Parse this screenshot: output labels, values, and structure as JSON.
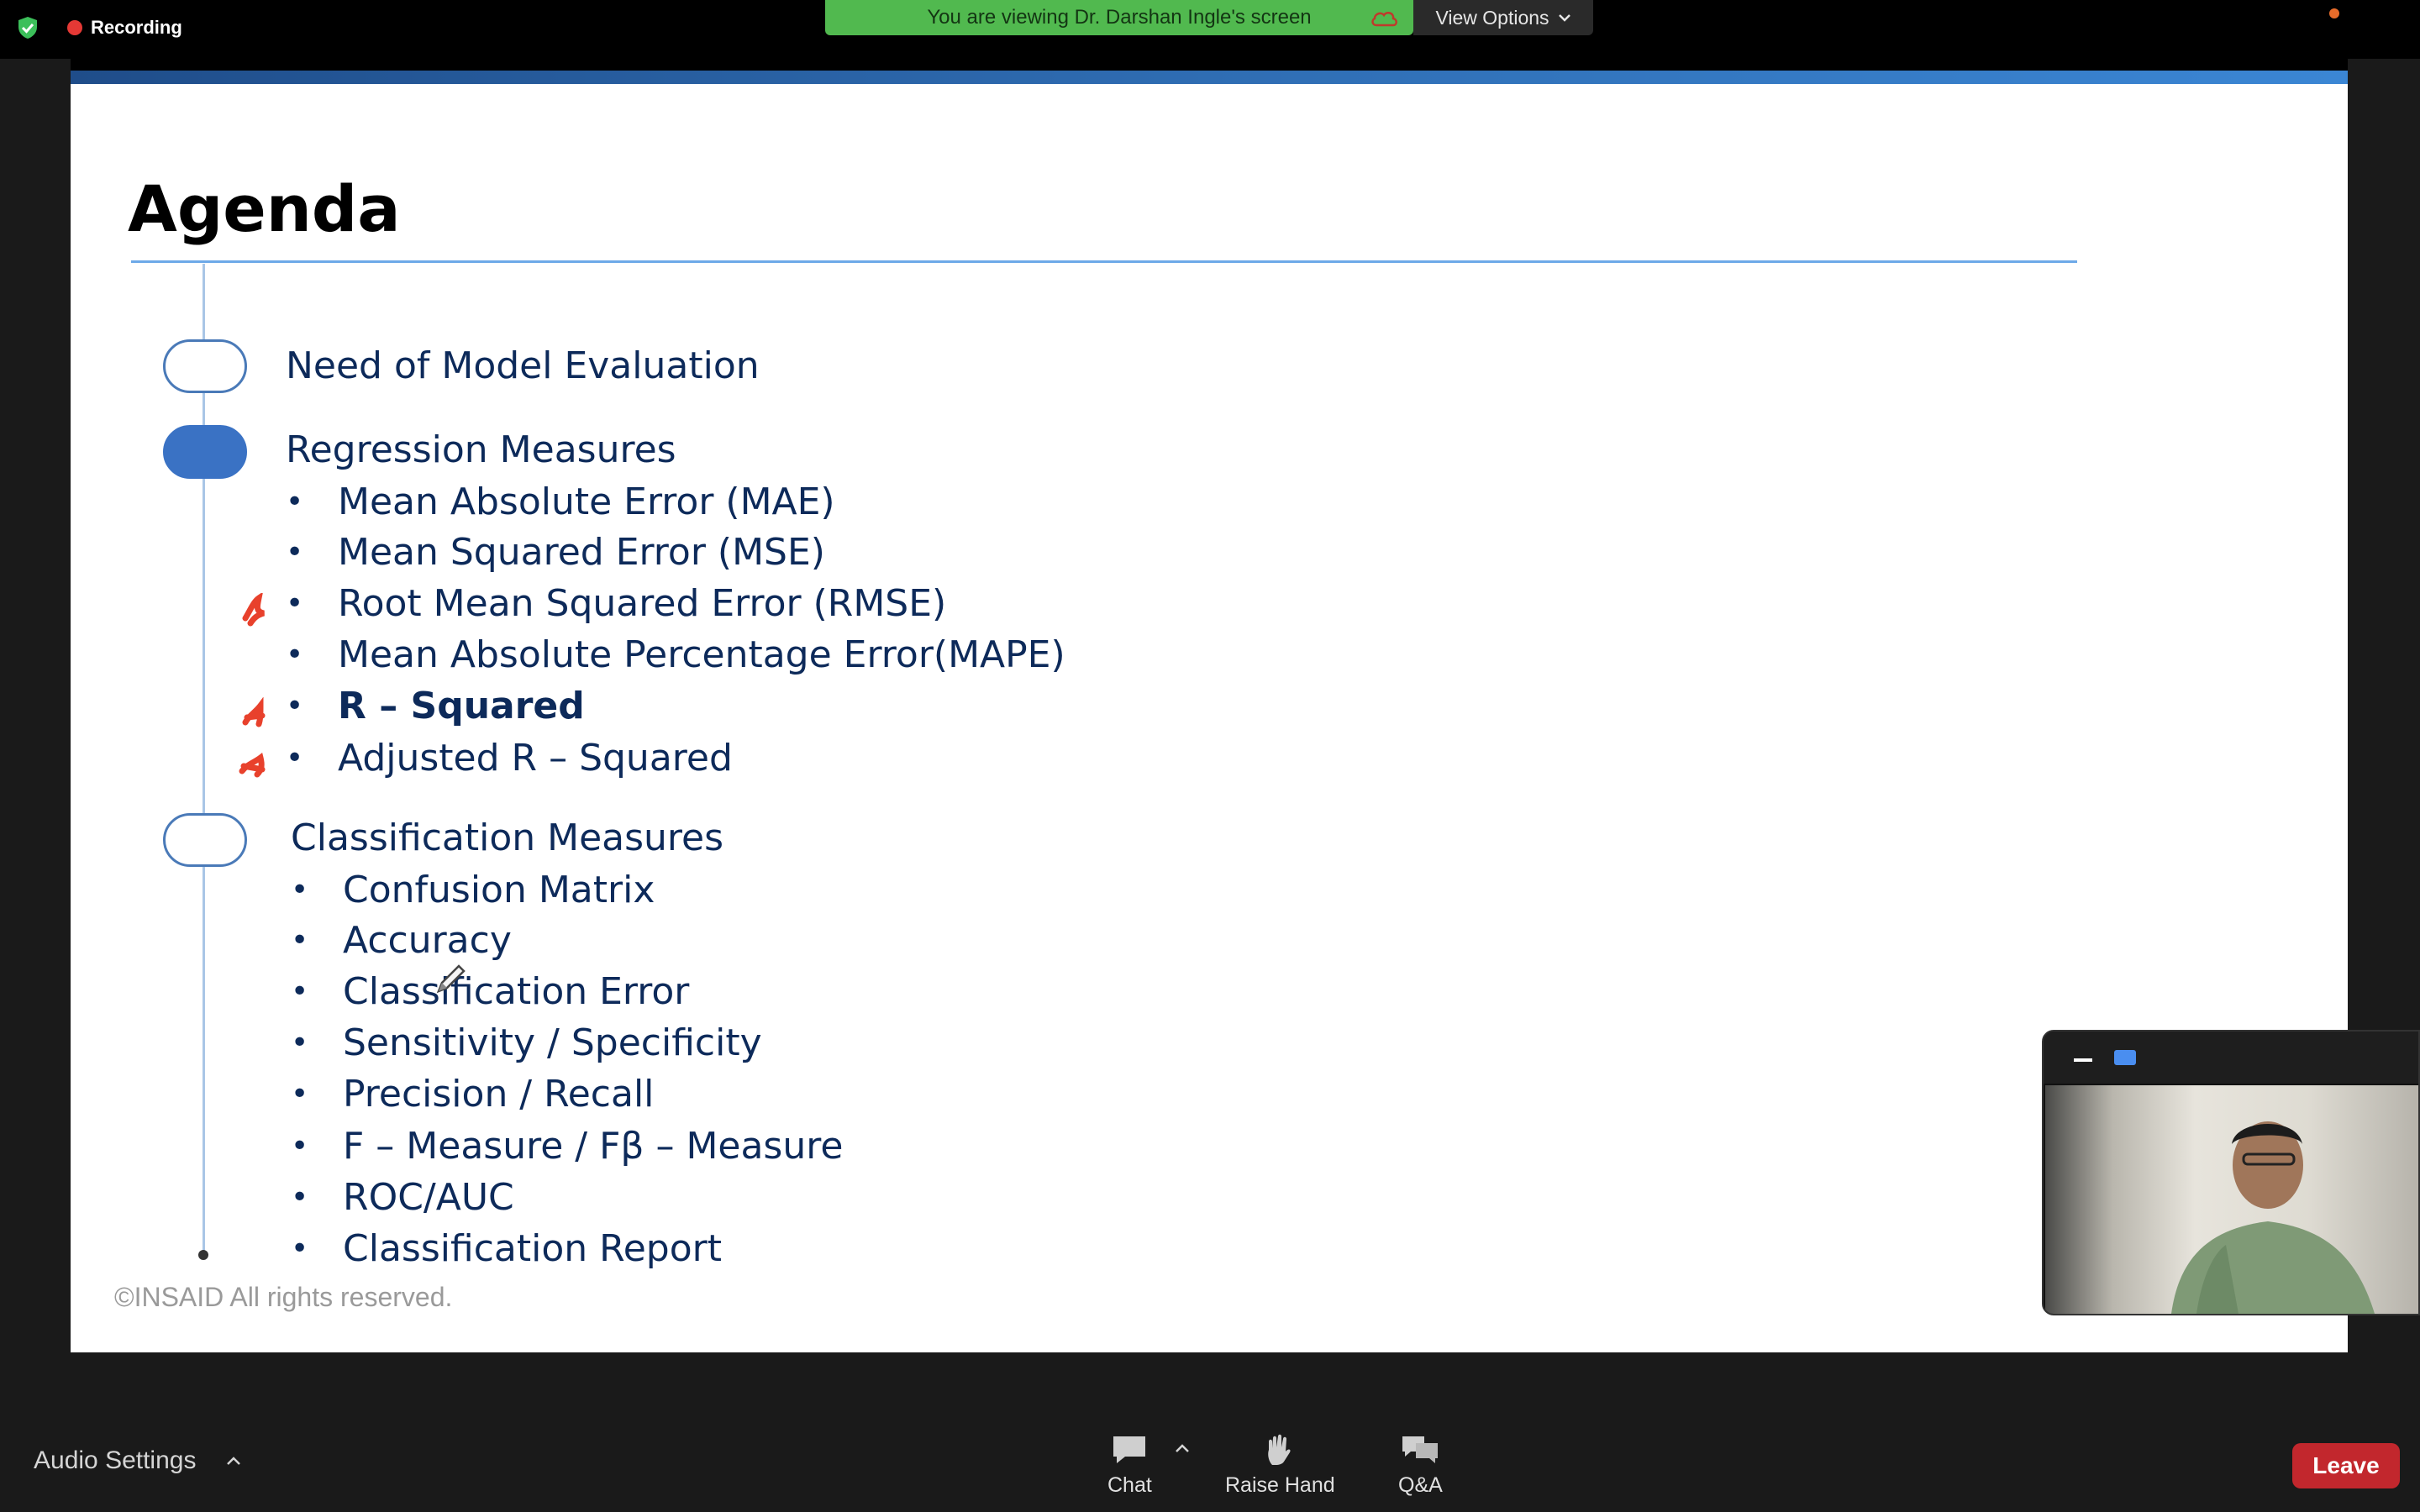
{
  "top_bar": {
    "recording_label": "Recording",
    "viewing_banner": "You are viewing Dr. Darshan Ingle's screen",
    "view_options_label": "View Options",
    "icons": [
      "shield-check-icon",
      "record-dot-icon",
      "cloud-icon",
      "chevron-down-icon"
    ]
  },
  "slide": {
    "title": "Agenda",
    "sections": [
      {
        "heading": "Need of Model Evaluation",
        "marker": "hollow",
        "items": []
      },
      {
        "heading": "Regression Measures",
        "marker": "filled",
        "items": [
          {
            "text": "Mean Absolute Error (MAE)",
            "bold": false,
            "annotated": false
          },
          {
            "text": "Mean Squared Error (MSE)",
            "bold": false,
            "annotated": false
          },
          {
            "text": "Root Mean Squared Error (RMSE)",
            "bold": false,
            "annotated": true
          },
          {
            "text": "Mean Absolute Percentage Error(MAPE)",
            "bold": false,
            "annotated": false
          },
          {
            "text": "R – Squared",
            "bold": true,
            "annotated": true
          },
          {
            "text": "Adjusted R – Squared",
            "bold": false,
            "annotated": true
          }
        ]
      },
      {
        "heading": "Classification Measures",
        "marker": "hollow",
        "items": [
          {
            "text": "Confusion Matrix"
          },
          {
            "text": "Accuracy"
          },
          {
            "text": "Classification Error"
          },
          {
            "text": "Sensitivity / Specificity"
          },
          {
            "text": "Precision / Recall"
          },
          {
            "text": "F – Measure / Fβ – Measure"
          },
          {
            "text": "ROC/AUC"
          },
          {
            "text": "Classification Report"
          }
        ]
      }
    ],
    "bullet_char": "•",
    "footer": "©INSAID All rights reserved.",
    "annotation_color": "#e8412c"
  },
  "self_view": {
    "icons": [
      "minimize-icon",
      "layout-icon"
    ]
  },
  "toolbar": {
    "audio_settings_label": "Audio Settings",
    "chat_label": "Chat",
    "raise_hand_label": "Raise Hand",
    "qa_label": "Q&A",
    "leave_label": "Leave",
    "colors": {
      "leave": "#c2272d",
      "background": "#1a1a1a"
    }
  }
}
